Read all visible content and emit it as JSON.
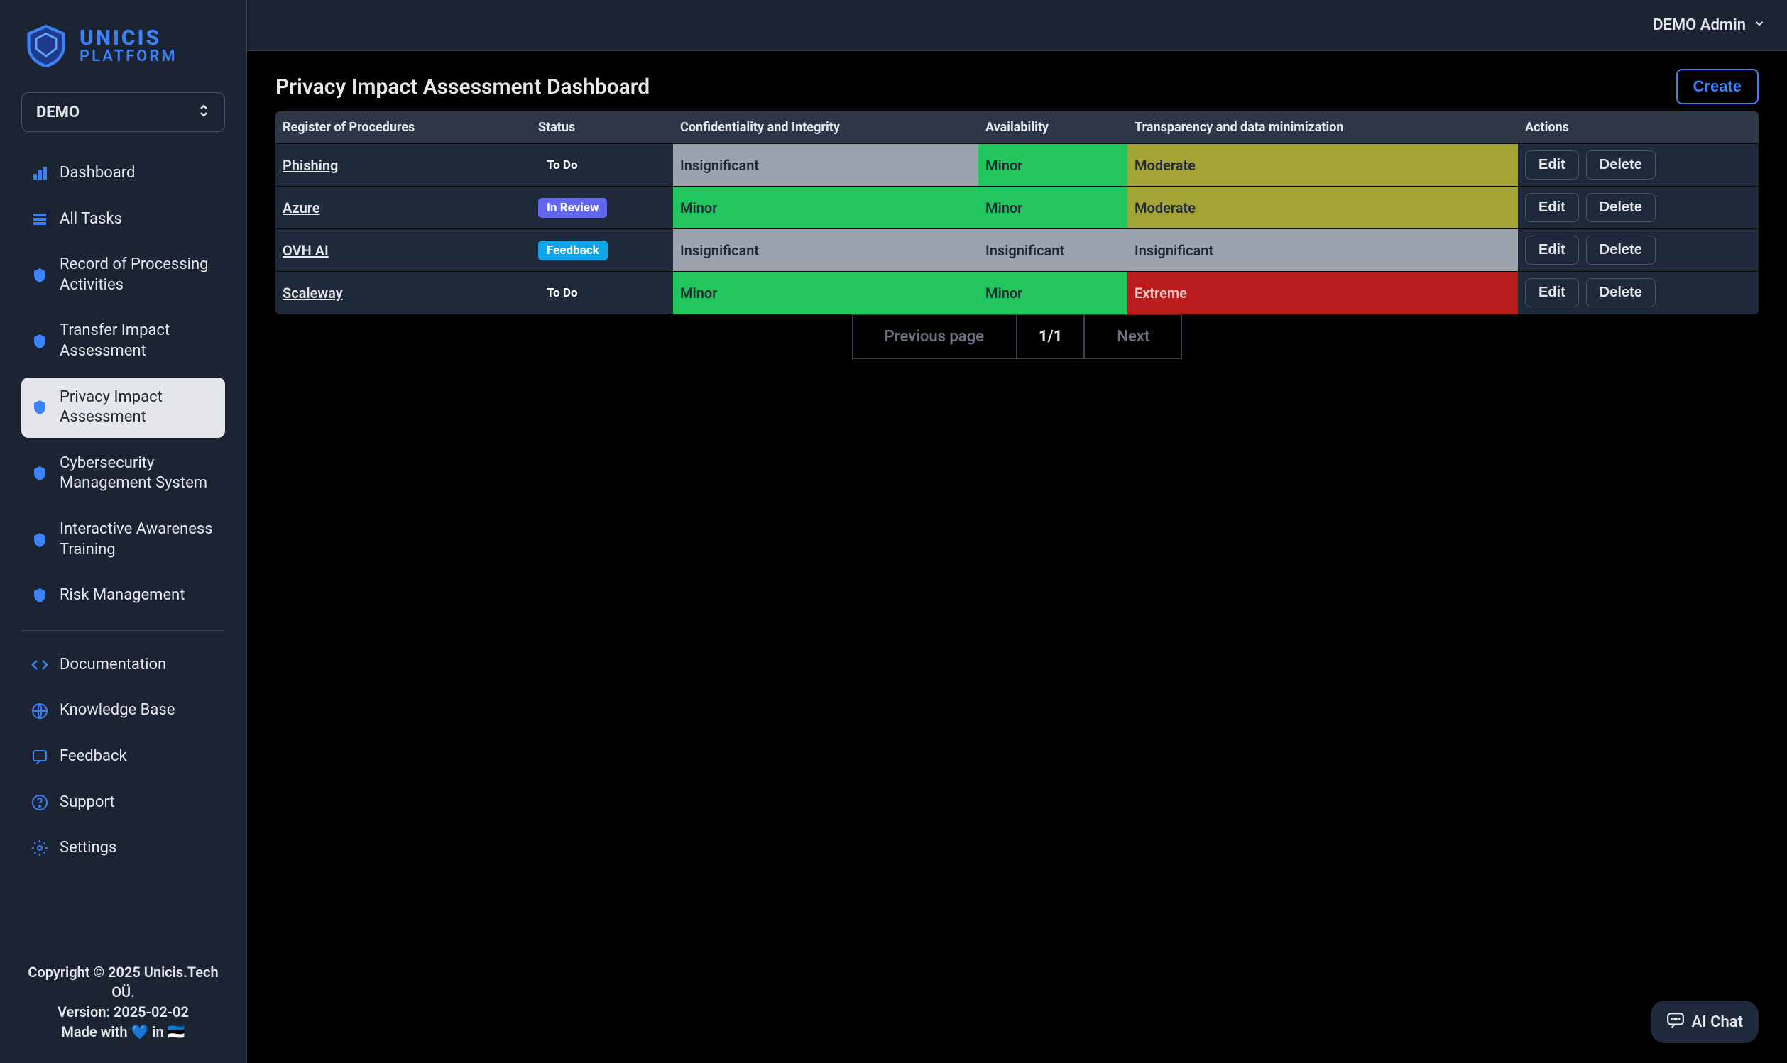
{
  "logo": {
    "main": "UNICIS",
    "sub": "PLATFORM"
  },
  "org_selector": {
    "label": "DEMO"
  },
  "sidebar": {
    "items": [
      {
        "label": "Dashboard",
        "icon": "bar-chart-icon",
        "color": "#3b82f6"
      },
      {
        "label": "All Tasks",
        "icon": "list-icon",
        "color": "#3b82f6"
      },
      {
        "label": "Record of Processing Activities",
        "icon": "shield-icon",
        "color": "#3b82f6"
      },
      {
        "label": "Transfer Impact Assessment",
        "icon": "shield-icon",
        "color": "#3b82f6"
      },
      {
        "label": "Privacy Impact Assessment",
        "icon": "shield-icon",
        "color": "#3b82f6"
      },
      {
        "label": "Cybersecurity Management System",
        "icon": "shield-icon",
        "color": "#3b82f6"
      },
      {
        "label": "Interactive Awareness Training",
        "icon": "shield-icon",
        "color": "#3b82f6"
      },
      {
        "label": "Risk Management",
        "icon": "shield-icon",
        "color": "#3b82f6"
      }
    ],
    "secondary": [
      {
        "label": "Documentation",
        "icon": "code-icon"
      },
      {
        "label": "Knowledge Base",
        "icon": "globe-icon"
      },
      {
        "label": "Feedback",
        "icon": "message-icon"
      },
      {
        "label": "Support",
        "icon": "help-icon"
      },
      {
        "label": "Settings",
        "icon": "gear-icon"
      }
    ]
  },
  "footer": {
    "copyright": "Copyright © 2025 Unicis.Tech OÜ.",
    "version": "Version: 2025-02-02",
    "made_with": "Made with 💙 in 🇪🇪"
  },
  "header": {
    "user": "DEMO Admin"
  },
  "page": {
    "title": "Privacy Impact Assessment Dashboard",
    "create_label": "Create"
  },
  "table": {
    "columns": [
      "Register of Procedures",
      "Status",
      "Confidentiality and Integrity",
      "Availability",
      "Transparency and data minimization",
      "Actions"
    ],
    "rows": [
      {
        "procedure": "Phishing",
        "status": {
          "label": "To Do",
          "class": "status-todo"
        },
        "confidentiality": {
          "label": "Insignificant",
          "class": "risk-insignificant"
        },
        "availability": {
          "label": "Minor",
          "class": "risk-minor"
        },
        "transparency": {
          "label": "Moderate",
          "class": "risk-moderate"
        }
      },
      {
        "procedure": "Azure",
        "status": {
          "label": "In Review",
          "class": "status-inreview"
        },
        "confidentiality": {
          "label": "Minor",
          "class": "risk-minor"
        },
        "availability": {
          "label": "Minor",
          "class": "risk-minor"
        },
        "transparency": {
          "label": "Moderate",
          "class": "risk-moderate"
        }
      },
      {
        "procedure": "OVH AI",
        "status": {
          "label": "Feedback",
          "class": "status-feedback"
        },
        "confidentiality": {
          "label": "Insignificant",
          "class": "risk-insignificant"
        },
        "availability": {
          "label": "Insignificant",
          "class": "risk-insignificant"
        },
        "transparency": {
          "label": "Insignificant",
          "class": "risk-insignificant"
        }
      },
      {
        "procedure": "Scaleway",
        "status": {
          "label": "To Do",
          "class": "status-todo"
        },
        "confidentiality": {
          "label": "Minor",
          "class": "risk-minor"
        },
        "availability": {
          "label": "Minor",
          "class": "risk-minor"
        },
        "transparency": {
          "label": "Extreme",
          "class": "risk-extreme"
        }
      }
    ],
    "actions": {
      "edit": "Edit",
      "delete": "Delete"
    }
  },
  "pagination": {
    "prev": "Previous page",
    "indicator": "1/1",
    "next": "Next"
  },
  "ai_chat": {
    "label": "AI Chat"
  }
}
